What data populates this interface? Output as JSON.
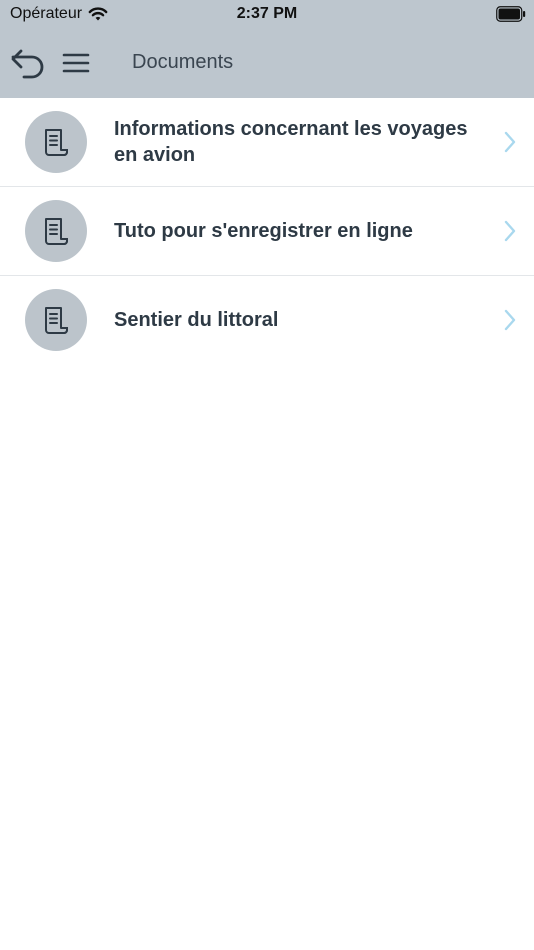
{
  "status_bar": {
    "carrier": "Opérateur",
    "time": "2:37 PM"
  },
  "nav": {
    "title": "Documents"
  },
  "colors": {
    "header_bg": "#bdc6ce",
    "avatar_bg": "#bcc4cb",
    "text": "#2e3a45",
    "chevron": "#a9d8ee"
  },
  "documents": [
    {
      "label": "Informations concernant les voyages en avion",
      "icon": "document-scroll-icon"
    },
    {
      "label": "Tuto pour s'enregistrer en ligne",
      "icon": "document-scroll-icon"
    },
    {
      "label": "Sentier du littoral",
      "icon": "document-scroll-icon"
    }
  ]
}
